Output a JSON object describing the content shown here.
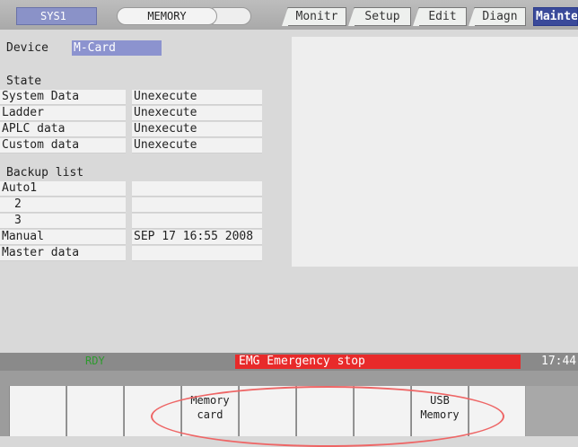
{
  "header": {
    "system_label": "SYS1",
    "mode_label": "MEMORY",
    "tabs": [
      {
        "label": "Monitr"
      },
      {
        "label": "Setup"
      },
      {
        "label": "Edit"
      },
      {
        "label": "Diagn"
      },
      {
        "label": "Mainte"
      }
    ]
  },
  "device": {
    "label": "Device",
    "value": "M-Card"
  },
  "state": {
    "title": "State",
    "rows": [
      {
        "label": "System Data",
        "value": "Unexecute"
      },
      {
        "label": "Ladder",
        "value": "Unexecute"
      },
      {
        "label": "APLC data",
        "value": "Unexecute"
      },
      {
        "label": "Custom data",
        "value": "Unexecute"
      }
    ]
  },
  "backup": {
    "title": "Backup list",
    "rows": [
      {
        "label": "Auto1",
        "value": ""
      },
      {
        "label": "2",
        "value": ""
      },
      {
        "label": "3",
        "value": ""
      },
      {
        "label": "Manual",
        "value": "SEP 17 16:55 2008"
      },
      {
        "label": "Master data",
        "value": ""
      }
    ]
  },
  "status": {
    "ready": "RDY",
    "emergency": "EMG  Emergency stop",
    "time": "17:44"
  },
  "softkeys": {
    "k1": "",
    "k2": "",
    "k3": "Memory\ncard",
    "k4": "",
    "k5": "",
    "k6": "",
    "k7": "USB\nMemory",
    "k8": ""
  },
  "colors": {
    "active_tab": "#3a4a9a",
    "emergency": "#e82a2a",
    "ready": "#2f9a2f",
    "highlight": "#8c93cf"
  }
}
